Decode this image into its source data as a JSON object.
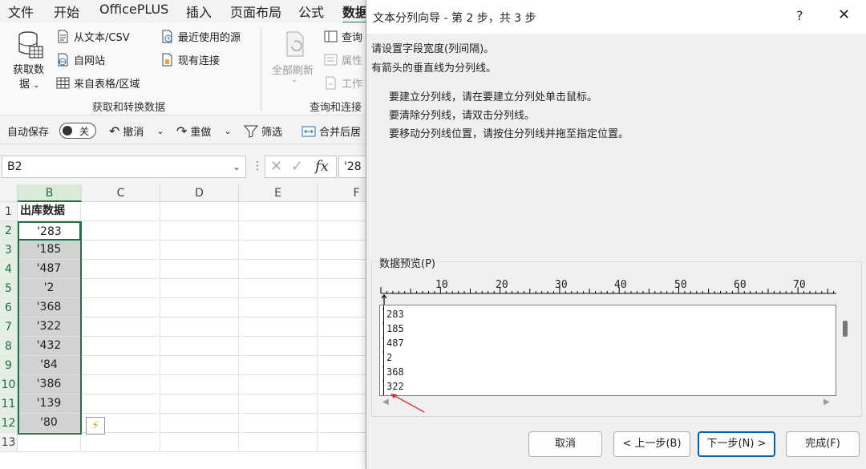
{
  "ribbon_tabs": [
    "文件",
    "开始",
    "OfficePLUS",
    "插入",
    "页面布局",
    "公式",
    "数据"
  ],
  "ribbon": {
    "get_data_label_1": "获取数",
    "get_data_label_2": "据",
    "from_text_csv": "从文本/CSV",
    "from_web": "自网站",
    "from_table": "来自表格/区域",
    "recent_sources": "最近使用的源",
    "existing_connections": "现有连接",
    "group_get_transform": "获取和转换数据",
    "refresh_all": "全部刷新",
    "queries": "查询",
    "properties": "属性",
    "workbook_links": "工作",
    "group_queries": "查询和连接"
  },
  "qat": {
    "autosave": "自动保存",
    "toggle_state": "关",
    "undo": "撤消",
    "redo": "重做",
    "filter": "筛选",
    "merge_center": "合并后居"
  },
  "formula_bar": {
    "name_box": "B2",
    "fx": "fx",
    "value": "'28"
  },
  "grid": {
    "columns": [
      "B",
      "C",
      "D",
      "E",
      "F"
    ],
    "rows": [
      "1",
      "2",
      "3",
      "4",
      "5",
      "6",
      "7",
      "8",
      "9",
      "10",
      "11",
      "12",
      "13"
    ],
    "b_header": "出库数据",
    "b_values": [
      "'283",
      "'185",
      "'487",
      "'2",
      "'368",
      "'322",
      "'432",
      "'84",
      "'386",
      "'139",
      "'80"
    ]
  },
  "dialog": {
    "title": "文本分列向导 - 第 2 步，共 3 步",
    "help": "?",
    "close": "✕",
    "instruction_1": "请设置字段宽度(列间隔)。",
    "instruction_2": "有箭头的垂直线为分列线。",
    "tip_1": "要建立分列线，请在要建立分列处单击鼠标。",
    "tip_2": "要清除分列线，请双击分列线。",
    "tip_3": "要移动分列线位置，请按住分列线并拖至指定位置。",
    "preview_label": "数据预览(P)",
    "ruler_numbers": [
      "10",
      "20",
      "30",
      "40",
      "50",
      "60",
      "70"
    ],
    "preview_lines": [
      "283",
      "185",
      "487",
      "2",
      "368",
      "322"
    ],
    "buttons": {
      "cancel": "取消",
      "back": "< 上一步(B)",
      "next": "下一步(N) >",
      "finish": "完成(F)"
    }
  },
  "colors": {
    "excel_green": "#217346",
    "selected_fill": "#d2d2d2",
    "annotation_red": "#d62b2b",
    "primary_button_border": "#0063b1"
  }
}
